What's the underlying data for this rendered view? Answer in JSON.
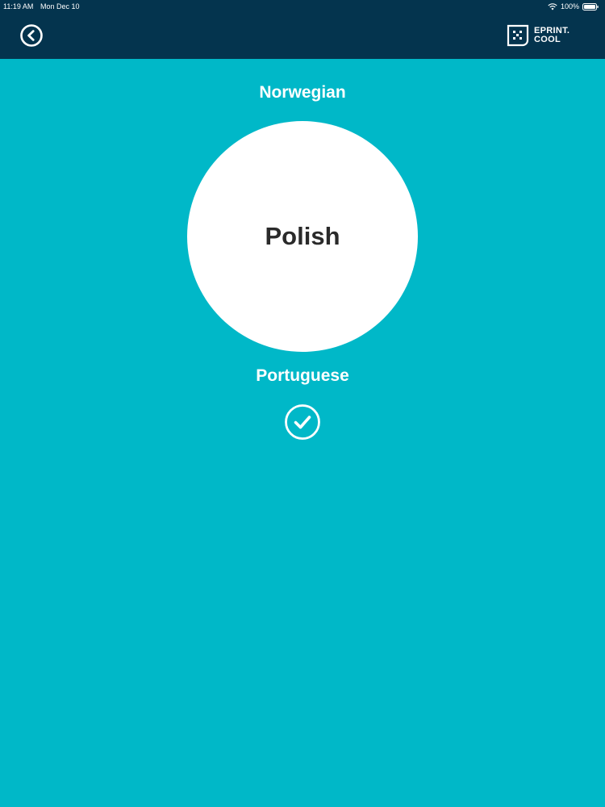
{
  "status_bar": {
    "time": "11:19 AM",
    "date": "Mon Dec 10",
    "battery": "100%"
  },
  "header": {
    "logo_line1": "EPRINT.",
    "logo_line2": "COOL",
    "back_icon": "chevron-left-circle-icon",
    "colors": {
      "bar": "#04344e",
      "text": "#ffffff"
    }
  },
  "picker": {
    "previous": "Norwegian",
    "selected": "Polish",
    "next": "Portuguese",
    "confirm_icon": "check-circle-icon"
  },
  "colors": {
    "background": "#00b8c8",
    "circle": "#ffffff",
    "selected_text": "#2a2a2a"
  }
}
